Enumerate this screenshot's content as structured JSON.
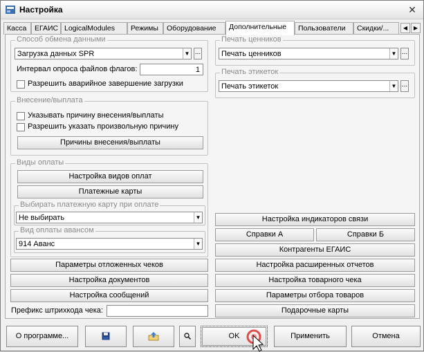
{
  "window": {
    "title": "Настройка",
    "close": "✕"
  },
  "tabs": [
    "Касса",
    "ЕГАИС",
    "LogicalModules",
    "Режимы",
    "Оборудование",
    "Дополнительные",
    "Пользователи",
    "Скидки/..."
  ],
  "exchange": {
    "legend": "Способ обмена данными",
    "mode_value": "Загрузка данных SPR",
    "interval_label": "Интервал опроса файлов флагов:",
    "interval_value": "1",
    "allow_emergency_label": "Разрешить аварийное завершение загрузки"
  },
  "deposit": {
    "legend": "Внесение/выплата",
    "specify_reason_label": "Указывать причину внесения/выплаты",
    "allow_arbitrary_label": "Разрешить указать произвольную причину",
    "reasons_button": "Причины внесения/выплаты"
  },
  "payments": {
    "legend": "Виды оплаты",
    "setup_button": "Настройка видов оплат",
    "cards_button": "Платежные карты",
    "choose_card_legend": "Выбирать платежную карту при оплате",
    "choose_card_value": "Не выбирать",
    "advance_legend": "Вид оплаты авансом",
    "advance_value": "914 Аванс"
  },
  "left_buttons": {
    "deferred": "Параметры отложенных чеков",
    "documents": "Настройка документов",
    "messages": "Настройка сообщений",
    "barcode_prefix_label": "Префикс штрихкода чека:",
    "barcode_prefix_value": ""
  },
  "price_tags": {
    "legend": "Печать ценников",
    "value": "Печать ценников"
  },
  "labels": {
    "legend": "Печать этикеток",
    "value": "Печать этикеток"
  },
  "right_buttons": {
    "indicators": "Настройка индикаторов связи",
    "ref_a": "Справки А",
    "ref_b": "Справки Б",
    "contractors": "Контрагенты ЕГАИС",
    "reports": "Настройка расширенных отчетов",
    "goods_receipt": "Настройка товарного чека",
    "goods_filter": "Параметры отбора товаров",
    "gift_cards": "Подарочные карты"
  },
  "bottom": {
    "about": "О программе...",
    "ok": "OK",
    "apply": "Применить",
    "cancel": "Отмена"
  },
  "icons": [
    "app-icon",
    "save-icon",
    "export-icon",
    "search-icon",
    "cursor-icon"
  ],
  "colors": {
    "legend_text": "#8a8a8a",
    "accent_red": "#e02020"
  }
}
